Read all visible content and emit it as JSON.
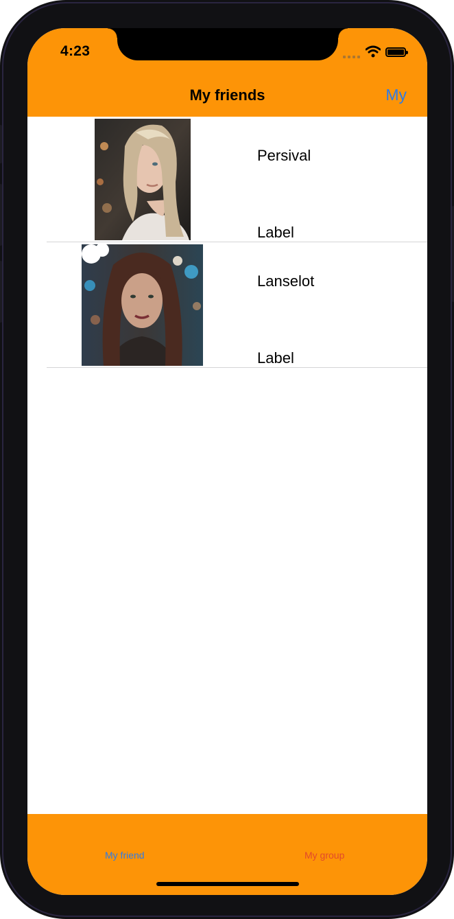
{
  "status_bar": {
    "time": "4:23"
  },
  "nav": {
    "title": "My friends",
    "right_button": "My"
  },
  "friends": [
    {
      "name": "Persival",
      "detail": "Label",
      "avatar_icon": "photo-blonde-woman"
    },
    {
      "name": "Lanselot",
      "detail": "Label",
      "avatar_icon": "photo-brunette-woman"
    }
  ],
  "tabs": [
    {
      "label": "My friend",
      "selected": true
    },
    {
      "label": "My group",
      "selected": false
    }
  ],
  "colors": {
    "bar_background": "#fd9407",
    "link_blue": "#2f7be5",
    "tab_unselected": "#e2492b"
  }
}
